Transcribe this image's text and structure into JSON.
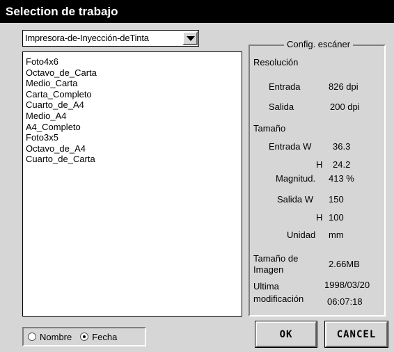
{
  "window": {
    "title": "Selection de trabajo"
  },
  "printer_select": {
    "value": "Impresora-de-Inyección-deTinta"
  },
  "job_list": {
    "items": [
      "Foto4x6",
      "Octavo_de_Carta",
      "Medio_Carta",
      "Carta_Completo",
      "Cuarto_de_A4",
      "Medio_A4",
      "A4_Completo",
      "Foto3x5",
      "Octavo_de_A4",
      "Cuarto_de_Carta"
    ]
  },
  "sort": {
    "options": [
      "Nombre",
      "Fecha"
    ],
    "selected": "Fecha"
  },
  "scanner_config": {
    "title": "Config. escáner",
    "resolution_label": "Resolución",
    "input_label": "Entrada",
    "input_value": "826 dpi",
    "output_label": "Salida",
    "output_value": "200 dpi",
    "size_label": "Tamaño",
    "input_w_label": "Entrada W",
    "input_w_value": "36.3",
    "input_h_label": "H",
    "input_h_value": "24.2",
    "magnitude_label": "Magnitud.",
    "magnitude_value": "413 %",
    "output_w_label": "Salida W",
    "output_w_value": "150",
    "output_h_label": "H",
    "output_h_value": "100",
    "unit_label": "Unidad",
    "unit_value": "mm",
    "image_size_label_1": "Tamaño de",
    "image_size_label_2": "Imagen",
    "image_size_value": "2.66MB",
    "last_mod_label_1": "Ultima",
    "last_mod_label_2": "modificación",
    "last_mod_date": "1998/03/20",
    "last_mod_time": "06:07:18"
  },
  "buttons": {
    "ok": "OK",
    "cancel": "CANCEL"
  }
}
